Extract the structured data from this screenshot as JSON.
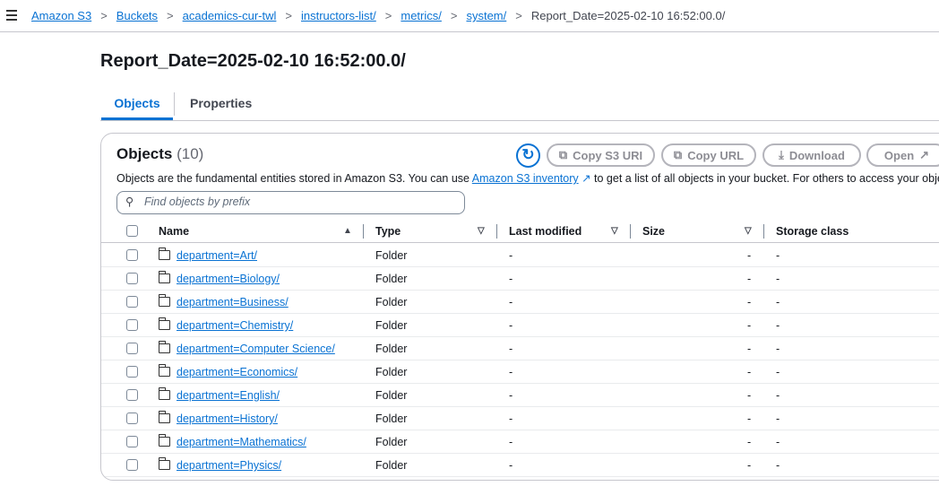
{
  "breadcrumb": {
    "items": [
      "Amazon S3",
      "Buckets",
      "academics-cur-twl",
      "instructors-list/",
      "metrics/",
      "system/"
    ],
    "current": "Report_Date=2025-02-10 16:52:00.0/"
  },
  "page_title": "Report_Date=2025-02-10 16:52:00.0/",
  "tabs": [
    "Objects",
    "Properties"
  ],
  "objects": {
    "title": "Objects",
    "count": "(10)",
    "description_pre": "Objects are the fundamental entities stored in Amazon S3. You can use ",
    "description_link": "Amazon S3 inventory",
    "description_post": " to get a list of all objects in your bucket. For others to access your objects, you",
    "buttons": {
      "copy_s3_uri": "Copy S3 URI",
      "copy_url": "Copy URL",
      "download": "Download",
      "open": "Open"
    },
    "search_placeholder": "Find objects by prefix",
    "columns": [
      "Name",
      "Type",
      "Last modified",
      "Size",
      "Storage class"
    ],
    "rows": [
      {
        "name": "department=Art/",
        "type": "Folder",
        "modified": "-",
        "size": "-",
        "storage": "-"
      },
      {
        "name": "department=Biology/",
        "type": "Folder",
        "modified": "-",
        "size": "-",
        "storage": "-"
      },
      {
        "name": "department=Business/",
        "type": "Folder",
        "modified": "-",
        "size": "-",
        "storage": "-"
      },
      {
        "name": "department=Chemistry/",
        "type": "Folder",
        "modified": "-",
        "size": "-",
        "storage": "-"
      },
      {
        "name": "department=Computer Science/",
        "type": "Folder",
        "modified": "-",
        "size": "-",
        "storage": "-"
      },
      {
        "name": "department=Economics/",
        "type": "Folder",
        "modified": "-",
        "size": "-",
        "storage": "-"
      },
      {
        "name": "department=English/",
        "type": "Folder",
        "modified": "-",
        "size": "-",
        "storage": "-"
      },
      {
        "name": "department=History/",
        "type": "Folder",
        "modified": "-",
        "size": "-",
        "storage": "-"
      },
      {
        "name": "department=Mathematics/",
        "type": "Folder",
        "modified": "-",
        "size": "-",
        "storage": "-"
      },
      {
        "name": "department=Physics/",
        "type": "Folder",
        "modified": "-",
        "size": "-",
        "storage": "-"
      }
    ]
  },
  "colors": {
    "link": "#0972d3",
    "text": "#16191f",
    "disabled": "#8d8d94"
  }
}
